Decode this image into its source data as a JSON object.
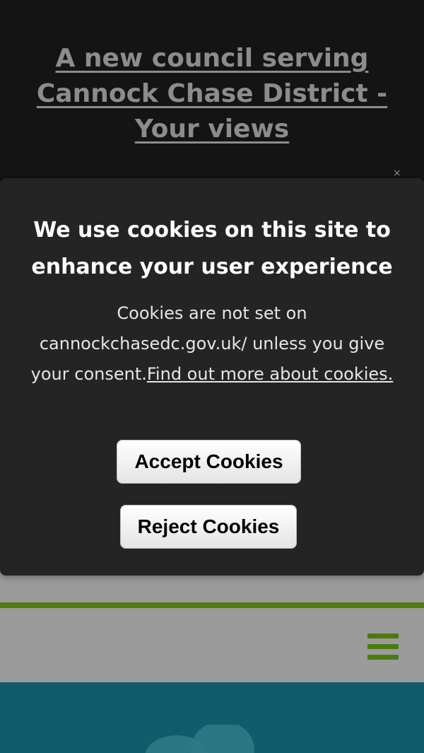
{
  "announcement": {
    "link_text": "A new council serving Cannock Chase District - Your views"
  },
  "cookie_banner": {
    "title": "We use cookies on this site to enhance your user experience",
    "body_text": "Cookies are not set on cannockchasedc.gov.uk/ unless you give your consent.",
    "more_link_text": "Find out more about cookies.",
    "accept_label": "Accept Cookies",
    "reject_label": "Reject Cookies"
  },
  "header": {
    "menu_icon": "hamburger-menu-icon"
  },
  "colors": {
    "accent_green": "#4a7b0e",
    "banner_dark": "#141414",
    "dialog_bg": "#242424",
    "hero_teal": "#105c6a"
  }
}
